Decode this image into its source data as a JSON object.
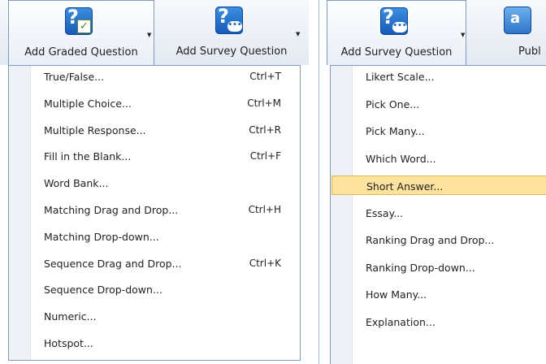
{
  "left": {
    "buttons": [
      {
        "label": "Add Graded Question",
        "icon": "graded-question-icon"
      },
      {
        "label": "Add Survey Question",
        "icon": "survey-question-icon"
      }
    ],
    "menu": [
      {
        "label": "True/False...",
        "shortcut": "Ctrl+T"
      },
      {
        "label": "Multiple Choice...",
        "shortcut": "Ctrl+M"
      },
      {
        "label": "Multiple Response...",
        "shortcut": "Ctrl+R"
      },
      {
        "label": "Fill in the Blank...",
        "shortcut": "Ctrl+F"
      },
      {
        "label": "Word Bank...",
        "shortcut": ""
      },
      {
        "label": "Matching Drag and Drop...",
        "shortcut": "Ctrl+H"
      },
      {
        "label": "Matching Drop-down...",
        "shortcut": ""
      },
      {
        "label": "Sequence Drag and Drop...",
        "shortcut": "Ctrl+K"
      },
      {
        "label": "Sequence Drop-down...",
        "shortcut": ""
      },
      {
        "label": "Numeric...",
        "shortcut": ""
      },
      {
        "label": "Hotspot...",
        "shortcut": ""
      }
    ]
  },
  "right": {
    "buttons": [
      {
        "label": "Add Survey Question",
        "icon": "survey-question-icon"
      },
      {
        "label": "Publ",
        "icon": "publish-icon"
      }
    ],
    "menu": [
      {
        "label": "Likert Scale..."
      },
      {
        "label": "Pick One..."
      },
      {
        "label": "Pick Many..."
      },
      {
        "label": "Which Word..."
      },
      {
        "label": "Short Answer...",
        "highlighted": true
      },
      {
        "label": "Essay..."
      },
      {
        "label": "Ranking Drag and Drop..."
      },
      {
        "label": "Ranking Drop-down..."
      },
      {
        "label": "How Many..."
      },
      {
        "label": "Explanation..."
      }
    ]
  },
  "colors": {
    "highlight": "#fde39e",
    "menu_border": "#7e9bbd",
    "icon_blue": "#1b63c6"
  }
}
